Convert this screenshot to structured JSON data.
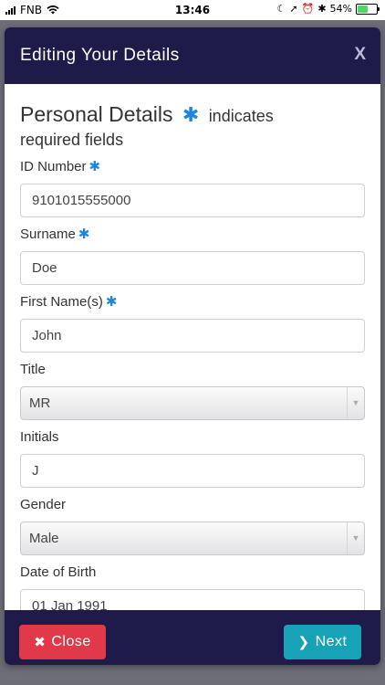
{
  "status_bar": {
    "carrier": "FNB",
    "time": "13:46",
    "battery_percent": "54%",
    "battery_level": 0.54
  },
  "modal": {
    "title": "Editing Your Details",
    "close_x": "X",
    "section": {
      "title": "Personal Details",
      "required_marker": "✱",
      "note": "indicates",
      "note_line2": "required fields"
    },
    "fields": {
      "id_number": {
        "label": "ID Number",
        "required": "✱",
        "value": "9101015555000"
      },
      "surname": {
        "label": "Surname",
        "required": "✱",
        "value": "Doe"
      },
      "first_names": {
        "label": "First Name(s)",
        "required": "✱",
        "value": "John"
      },
      "title": {
        "label": "Title",
        "value": "MR"
      },
      "initials": {
        "label": "Initials",
        "value": "J"
      },
      "gender": {
        "label": "Gender",
        "value": "Male"
      },
      "dob": {
        "label": "Date of Birth",
        "value": "01 Jan 1991"
      }
    },
    "footer": {
      "close_label": "Close",
      "next_label": "Next"
    }
  },
  "colors": {
    "header_bg": "#1e1b4b",
    "required_star": "#1a86e0",
    "close_btn": "#e2394a",
    "next_btn": "#18a2b8"
  }
}
